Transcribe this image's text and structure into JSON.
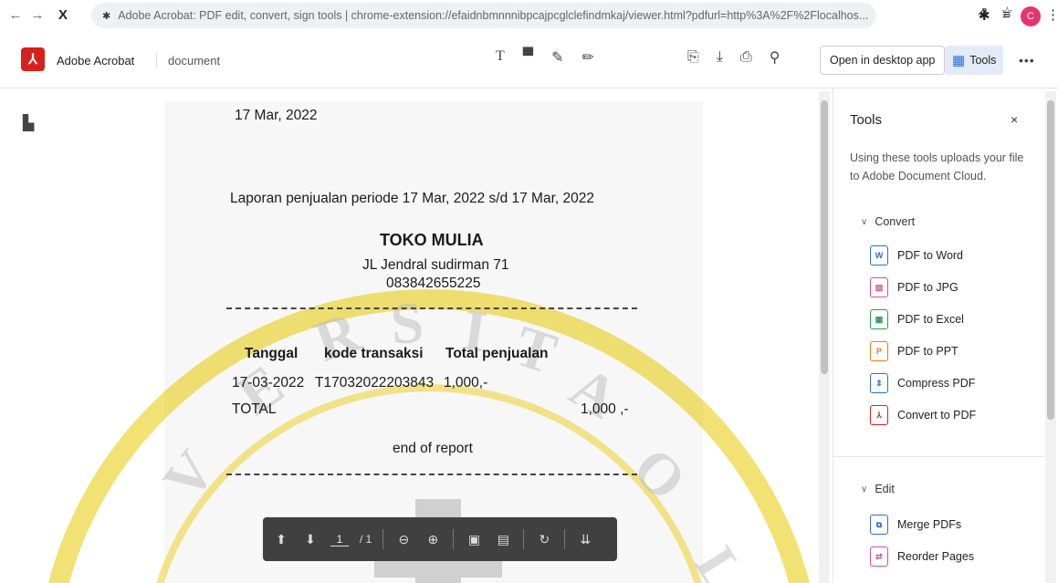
{
  "browser": {
    "back": "←",
    "forward": "→",
    "stop": "X",
    "extension_icon": "puzzle-icon",
    "url": "Adobe Acrobat: PDF edit, convert, sign tools | chrome-extension://efaidnbmnnnibpcajpcglclefindmkaj/viewer.html?pdfurl=http%3A%2F%2Flocalhos...",
    "avatar_letter": "C"
  },
  "header": {
    "app_name": "Adobe Acrobat",
    "doc_name": "document",
    "open_desktop_label": "Open in desktop app",
    "tools_label": "Tools",
    "more_label": "•••"
  },
  "document": {
    "date": "17 Mar, 2022",
    "report_line": "Laporan penjualan periode 17 Mar, 2022 s/d 17 Mar, 2022",
    "store_name": "TOKO MULIA",
    "address": "JL Jendral sudirman 71",
    "phone": "083842655225",
    "col_date": "Tanggal",
    "col_code": "kode transaksi",
    "col_total": "Total penjualan",
    "row_date": "17-03-2022",
    "row_code": "T17032022203843",
    "row_amount": "1,000,-",
    "total_label": "TOTAL",
    "total_value": "1,000 ,-",
    "end_text": "end of report"
  },
  "page_toolbar": {
    "current_page": "1",
    "total_pages": "/ 1"
  },
  "tools_panel": {
    "title": "Tools",
    "close": "×",
    "description": "Using these tools uploads your file to Adobe Document Cloud.",
    "sections": [
      {
        "label": "Convert",
        "items": [
          {
            "label": "PDF to Word",
            "color": "#2b6fd6"
          },
          {
            "label": "PDF to JPG",
            "color": "#d64f9a"
          },
          {
            "label": "PDF to Excel",
            "color": "#2e9a4e"
          },
          {
            "label": "PDF to PPT",
            "color": "#e57c1f"
          },
          {
            "label": "Compress PDF",
            "color": "#2b6fd6"
          },
          {
            "label": "Convert to PDF",
            "color": "#d7211d"
          }
        ]
      },
      {
        "label": "Edit",
        "items": [
          {
            "label": "Merge PDFs",
            "color": "#2b6fd6"
          },
          {
            "label": "Reorder Pages",
            "color": "#d64f9a"
          }
        ]
      }
    ]
  },
  "colors": {
    "acrobat_red": "#d7211d",
    "tools_active_bg": "#e3ebf8",
    "watermark": "#e8c800"
  }
}
